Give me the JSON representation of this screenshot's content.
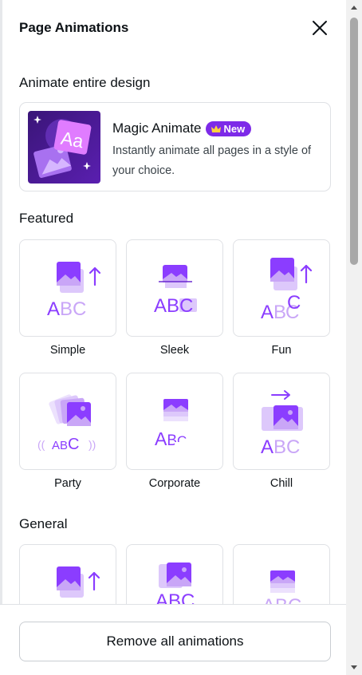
{
  "panel": {
    "title": "Page Animations"
  },
  "sections": {
    "entire": "Animate entire design",
    "featured": "Featured",
    "general": "General"
  },
  "magic_animate": {
    "title": "Magic Animate",
    "badge": "New",
    "description": "Instantly animate all pages in a style of your choice."
  },
  "featured_tiles": [
    {
      "label": "Simple"
    },
    {
      "label": "Sleek"
    },
    {
      "label": "Fun"
    },
    {
      "label": "Party"
    },
    {
      "label": "Corporate"
    },
    {
      "label": "Chill"
    }
  ],
  "tile_texts": {
    "abc": "ABC",
    "arc": "ABC",
    "a_b_c": [
      "A",
      "B",
      "C"
    ],
    "party_brackets": [
      "((",
      "))"
    ]
  },
  "footer": {
    "remove_label": "Remove all animations"
  },
  "colors": {
    "accent": "#7d2ae8",
    "icon_dark": "#8b3dff",
    "icon_light": "#c9a6f7"
  }
}
